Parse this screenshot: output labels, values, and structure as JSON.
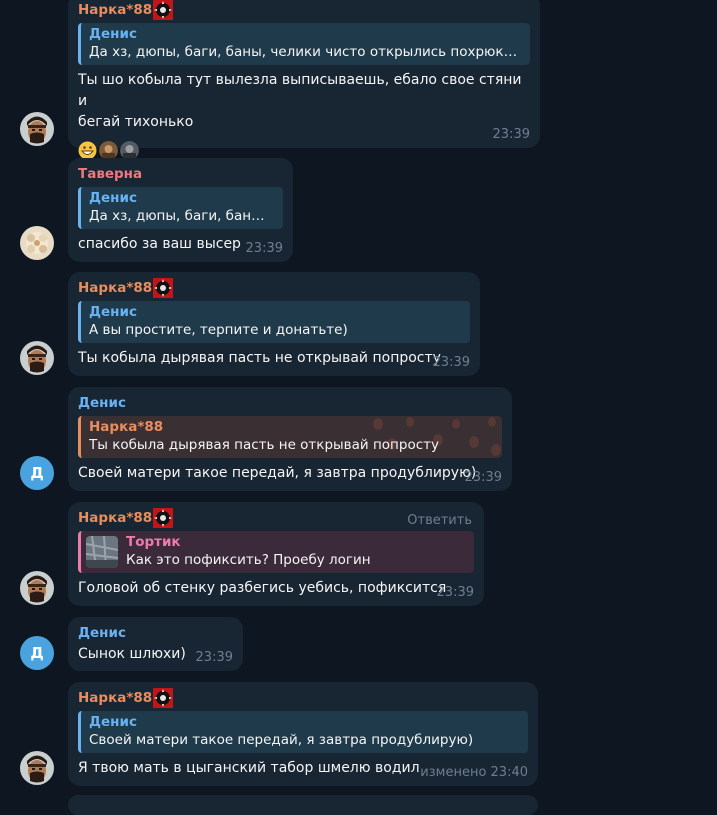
{
  "colors": {
    "background": "#0e1621",
    "bubble": "#182533",
    "reply_bg": "#1f3a4b",
    "name_narka": "#e88d5d",
    "name_taverna": "#f0777e",
    "name_denis": "#6ab2f2",
    "name_tortik": "#ee7aae",
    "timestamp": "#6d7f8f"
  },
  "messages": [
    {
      "sender": "Нарка*88",
      "reply_name": "Денис",
      "reply_text": "Да хз, дюпы, баги, баны, челики чисто открылись похрюкат...",
      "text_line1": "Ты шо кобыла тут вылезла выписываешь, ебало свое стяни и",
      "text_line2": "бегай тихонько",
      "reactions": [
        "grin-emoji",
        "user-avatar",
        "user-avatar"
      ],
      "time": "23:39"
    },
    {
      "sender": "Таверна",
      "reply_name": "Денис",
      "reply_text": "Да хз, дюпы, баги, баны, ...",
      "text": "спасибо за ваш высер",
      "time": "23:39"
    },
    {
      "sender": "Нарка*88",
      "reply_name": "Денис",
      "reply_text": "А вы простите, терпите и донатьте)",
      "text": "Ты кобыла дырявая пасть не открывай попросту",
      "time": "23:39"
    },
    {
      "sender": "Денис",
      "reply_name": "Нарка*88",
      "reply_text": "Ты кобыла дырявая пасть не открывай попросту",
      "text": "Своей матери такое передай, я завтра продублирую)",
      "time": "23:39",
      "avatar_letter": "Д"
    },
    {
      "sender": "Нарка*88",
      "reply_action": "Ответить",
      "reply_name": "Тортик",
      "reply_text": "Как это пофиксить? Проебу логин",
      "text": "Головой об стенку разбегись уебись, пофиксится",
      "time": "23:39"
    },
    {
      "sender": "Денис",
      "text": "Сынок шлюхи)",
      "time": "23:39",
      "avatar_letter": "Д"
    },
    {
      "sender": "Нарка*88",
      "reply_name": "Денис",
      "reply_text": "Своей матери такое передай, я завтра продублирую)",
      "text": "Я твою мать в цыганский  табор шмелю водил",
      "time": "изменено 23:40"
    }
  ]
}
